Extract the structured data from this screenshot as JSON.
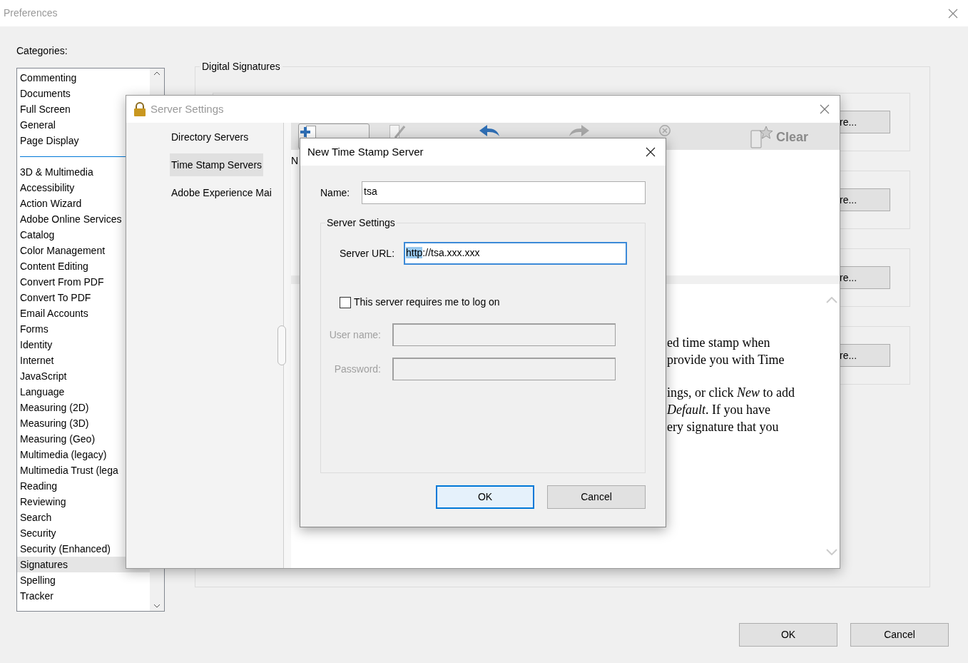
{
  "window": {
    "title": "Preferences"
  },
  "categories": {
    "label": "Categories:",
    "groups": [
      {
        "items": [
          {
            "label": "Commenting",
            "selected": false
          },
          {
            "label": "Documents",
            "selected": false
          },
          {
            "label": "Full Screen",
            "selected": false
          },
          {
            "label": "General",
            "selected": false
          },
          {
            "label": "Page Display",
            "selected": false
          }
        ]
      },
      {
        "items": [
          {
            "label": "3D & Multimedia",
            "selected": false
          },
          {
            "label": "Accessibility",
            "selected": false
          },
          {
            "label": "Action Wizard",
            "selected": false
          },
          {
            "label": "Adobe Online Services",
            "selected": false
          },
          {
            "label": "Catalog",
            "selected": false
          },
          {
            "label": "Color Management",
            "selected": false
          },
          {
            "label": "Content Editing",
            "selected": false
          },
          {
            "label": "Convert From PDF",
            "selected": false
          },
          {
            "label": "Convert To PDF",
            "selected": false
          },
          {
            "label": "Email Accounts",
            "selected": false
          },
          {
            "label": "Forms",
            "selected": false
          },
          {
            "label": "Identity",
            "selected": false
          },
          {
            "label": "Internet",
            "selected": false
          },
          {
            "label": "JavaScript",
            "selected": false
          },
          {
            "label": "Language",
            "selected": false
          },
          {
            "label": "Measuring (2D)",
            "selected": false
          },
          {
            "label": "Measuring (3D)",
            "selected": false
          },
          {
            "label": "Measuring (Geo)",
            "selected": false
          },
          {
            "label": "Multimedia (legacy)",
            "selected": false
          },
          {
            "label": "Multimedia Trust (lega",
            "selected": false
          },
          {
            "label": "Reading",
            "selected": false
          },
          {
            "label": "Reviewing",
            "selected": false
          },
          {
            "label": "Search",
            "selected": false
          },
          {
            "label": "Security",
            "selected": false
          },
          {
            "label": "Security (Enhanced)",
            "selected": false
          },
          {
            "label": "Signatures",
            "selected": true
          },
          {
            "label": "Spelling",
            "selected": false
          },
          {
            "label": "Tracker",
            "selected": false
          }
        ]
      }
    ]
  },
  "digital_signatures": {
    "title": "Digital Signatures",
    "sections": [
      {
        "button": "re..."
      },
      {
        "button": "re..."
      },
      {
        "button": "re..."
      },
      {
        "button": "re..."
      }
    ]
  },
  "buttons": [
    {
      "label": "OK"
    },
    {
      "label": "Cancel"
    }
  ],
  "server_settings": {
    "title": "Server Settings",
    "nav": [
      {
        "label": "Directory Servers",
        "selected": false
      },
      {
        "label": "Time Stamp Servers",
        "selected": true
      },
      {
        "label": "Adobe Experience Mai",
        "selected": false
      }
    ],
    "toolbar": [
      {
        "kind": "new",
        "disabled": false,
        "pressed": true
      },
      {
        "kind": "edit",
        "disabled": true,
        "pressed": false
      },
      {
        "kind": "import",
        "disabled": false,
        "pressed": false
      },
      {
        "kind": "export",
        "disabled": true,
        "pressed": false
      },
      {
        "kind": "remove",
        "disabled": true,
        "pressed": false
      },
      {
        "kind": "clear",
        "label": "Clear",
        "disabled": true,
        "pressed": false
      }
    ],
    "list_header": "N",
    "description": [
      [
        "ed time stamp when",
        "provide you with Time"
      ],
      [
        "ings, or click *New* to add",
        "*Default*. If you have",
        "ery signature that you"
      ]
    ]
  },
  "new_server_dialog": {
    "title": "New Time Stamp Server",
    "name_label": "Name:",
    "name_value": "tsa",
    "group_title": "Server Settings",
    "url_label": "Server URL:",
    "url_selected": "http",
    "url_rest": "://tsa.xxx.xxx",
    "login": {
      "label": "This server requires me to log on",
      "checked": false
    },
    "username": {
      "label": "User name:",
      "disabled": true
    },
    "password": {
      "label": "Password:",
      "disabled": true
    },
    "buttons": [
      {
        "label": "OK",
        "default": true
      },
      {
        "label": "Cancel",
        "default": false
      }
    ]
  }
}
